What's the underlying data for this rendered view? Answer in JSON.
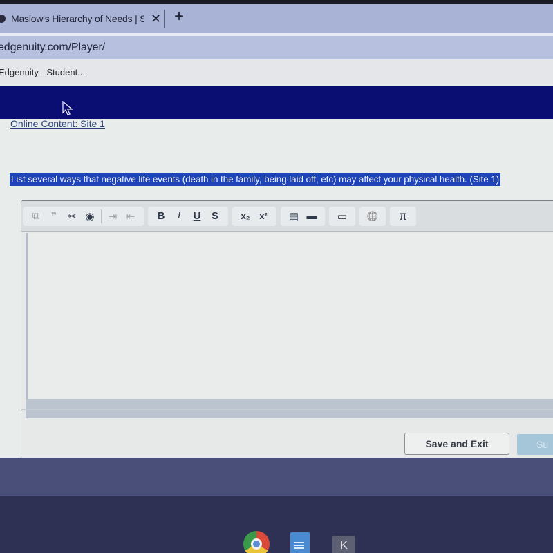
{
  "browser": {
    "tab_title": "Maslow's Hierarchy of Needs | S",
    "tab_close": "✕",
    "new_tab": "+",
    "url": "edgenuity.com/Player/",
    "bookmark": "Edgenuity - Student..."
  },
  "page": {
    "content_link": "Online Content: Site 1",
    "question": "List several ways that negative life events (death in the family, being laid off, etc) may affect your physical health. (Site 1)",
    "editor": {
      "toolbar": {
        "copy": "⧉",
        "quote": "❞",
        "cut": "✂",
        "record": "◉",
        "indent": "⇥",
        "outdent": "⇤",
        "bold": "B",
        "italic": "I",
        "underline": "U",
        "strike": "S",
        "subscript": "x₂",
        "superscript": "x²",
        "table": "▤",
        "fill_blank": "▬",
        "text_box": "▭",
        "link": "🌐",
        "math": "π"
      },
      "value": ""
    },
    "buttons": {
      "save_exit": "Save and Exit",
      "submit": "Su"
    }
  },
  "shelf": {
    "apps": [
      "Chrome",
      "Docs",
      "K"
    ],
    "k_label": "K"
  },
  "colors": {
    "navy_bar": "#0a0e72",
    "question_highlight": "#1d44b8",
    "link": "#2a3f7a"
  }
}
